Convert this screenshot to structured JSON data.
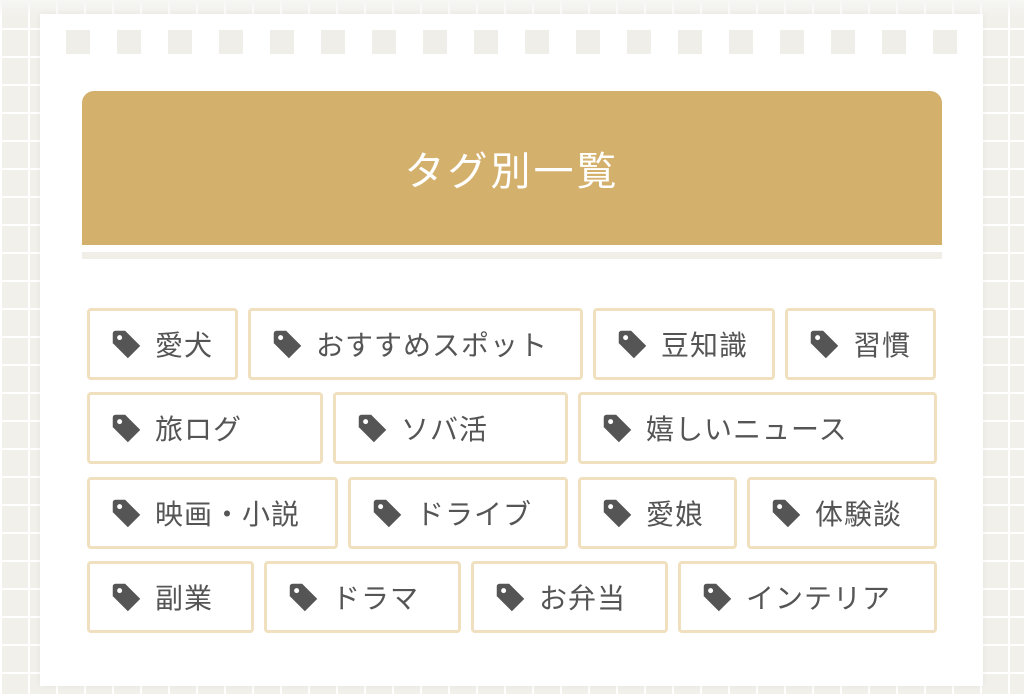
{
  "section": {
    "title": "タグ別一覧"
  },
  "tags": [
    {
      "label": "愛犬",
      "icon": "tag-icon"
    },
    {
      "label": "おすすめスポット",
      "icon": "tag-icon"
    },
    {
      "label": "豆知識",
      "icon": "tag-icon"
    },
    {
      "label": "習慣",
      "icon": "tag-icon"
    },
    {
      "label": "旅ログ",
      "icon": "tag-icon"
    },
    {
      "label": "ソバ活",
      "icon": "tag-icon"
    },
    {
      "label": "嬉しいニュース",
      "icon": "tag-icon"
    },
    {
      "label": "映画・小説",
      "icon": "tag-icon"
    },
    {
      "label": "ドライブ",
      "icon": "tag-icon"
    },
    {
      "label": "愛娘",
      "icon": "tag-icon"
    },
    {
      "label": "体験談",
      "icon": "tag-icon"
    },
    {
      "label": "副業",
      "icon": "tag-icon"
    },
    {
      "label": "ドラマ",
      "icon": "tag-icon"
    },
    {
      "label": "お弁当",
      "icon": "tag-icon"
    },
    {
      "label": "インテリア",
      "icon": "tag-icon"
    }
  ],
  "colors": {
    "heading_background": "#d4b06d",
    "heading_text": "#ffffff",
    "tag_border": "#f0e0c0",
    "tag_text": "#555555",
    "tag_icon": "#555555",
    "page_background": "#f1f0ea"
  }
}
